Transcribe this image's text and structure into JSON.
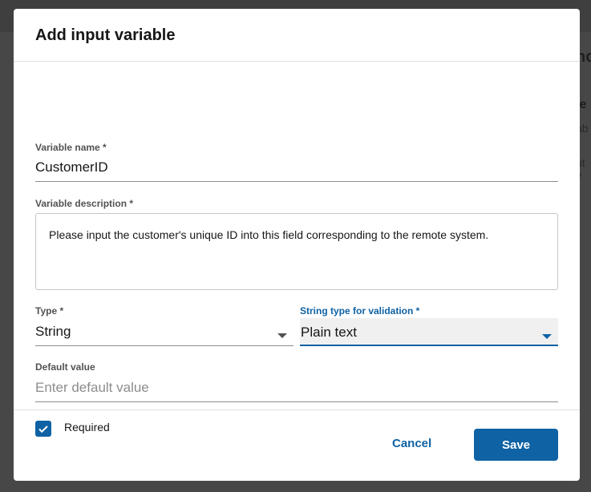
{
  "background": {
    "fragments": [
      "nc",
      "le",
      "ab",
      "ut v"
    ]
  },
  "dialog": {
    "title": "Add input variable",
    "variable_name": {
      "label": "Variable name *",
      "value": "CustomerID"
    },
    "variable_description": {
      "label": "Variable description *",
      "value": "Please input the customer's unique ID into this field corresponding to the remote system."
    },
    "type": {
      "label": "Type *",
      "value": "String"
    },
    "string_type": {
      "label": "String type for validation *",
      "value": "Plain text"
    },
    "default_value": {
      "label": "Default value",
      "placeholder": "Enter default value",
      "value": ""
    },
    "required": {
      "label": "Required",
      "checked": true
    },
    "cancel_label": "Cancel",
    "save_label": "Save"
  },
  "colors": {
    "accent": "#0f62a4"
  }
}
